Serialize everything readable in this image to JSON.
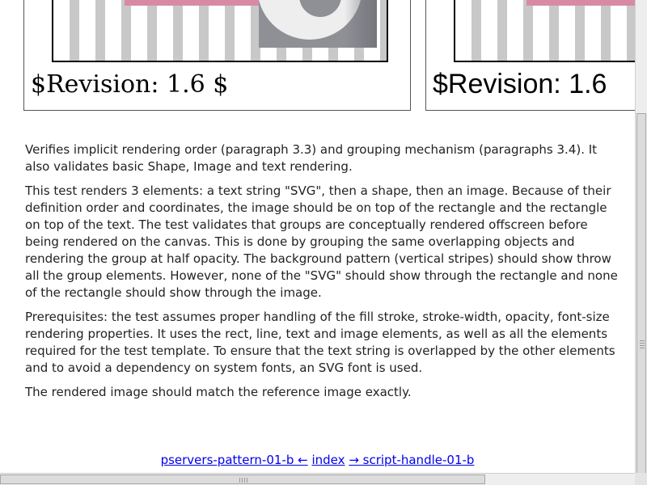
{
  "panels": {
    "left_revision": "$Revision: 1.6 $",
    "right_revision": "$Revision: 1.6"
  },
  "description": {
    "p1": "Verifies implicit rendering order (paragraph 3.3) and grouping mechanism (paragraphs 3.4). It also validates basic Shape, Image and text rendering.",
    "p2": "This test renders 3 elements: a text string \"SVG\", then a shape, then an image. Because of their definition order and coordinates, the image should be on top of the rectangle and the rectangle on top of the text. The test validates that groups are conceptually rendered offscreen before being rendered on the canvas. This is done by grouping the same overlapping objects and rendering the group at half opacity. The background pattern (vertical stripes) should show throw all the group elements. However, none of the \"SVG\" should show through the rectangle and none of the rectangle should show through the image.",
    "p3": "Prerequisites: the test assumes proper handling of the fill stroke, stroke-width, opacity, font-size rendering properties. It uses the rect, line, text and image elements, as well as all the elements required for the test template. To ensure that the text string is overlapped by the other elements and to avoid a dependency on system fonts, an SVG font is used.",
    "p4": "The rendered image should match the reference image exactly."
  },
  "nav": {
    "prev": "pservers-pattern-01-b ←",
    "index": "index",
    "next": "→ script-handle-01-b"
  },
  "colors": {
    "stripe": "#c8c8c8",
    "pink_bar": "#d78aa6",
    "link": "#0000ee"
  }
}
